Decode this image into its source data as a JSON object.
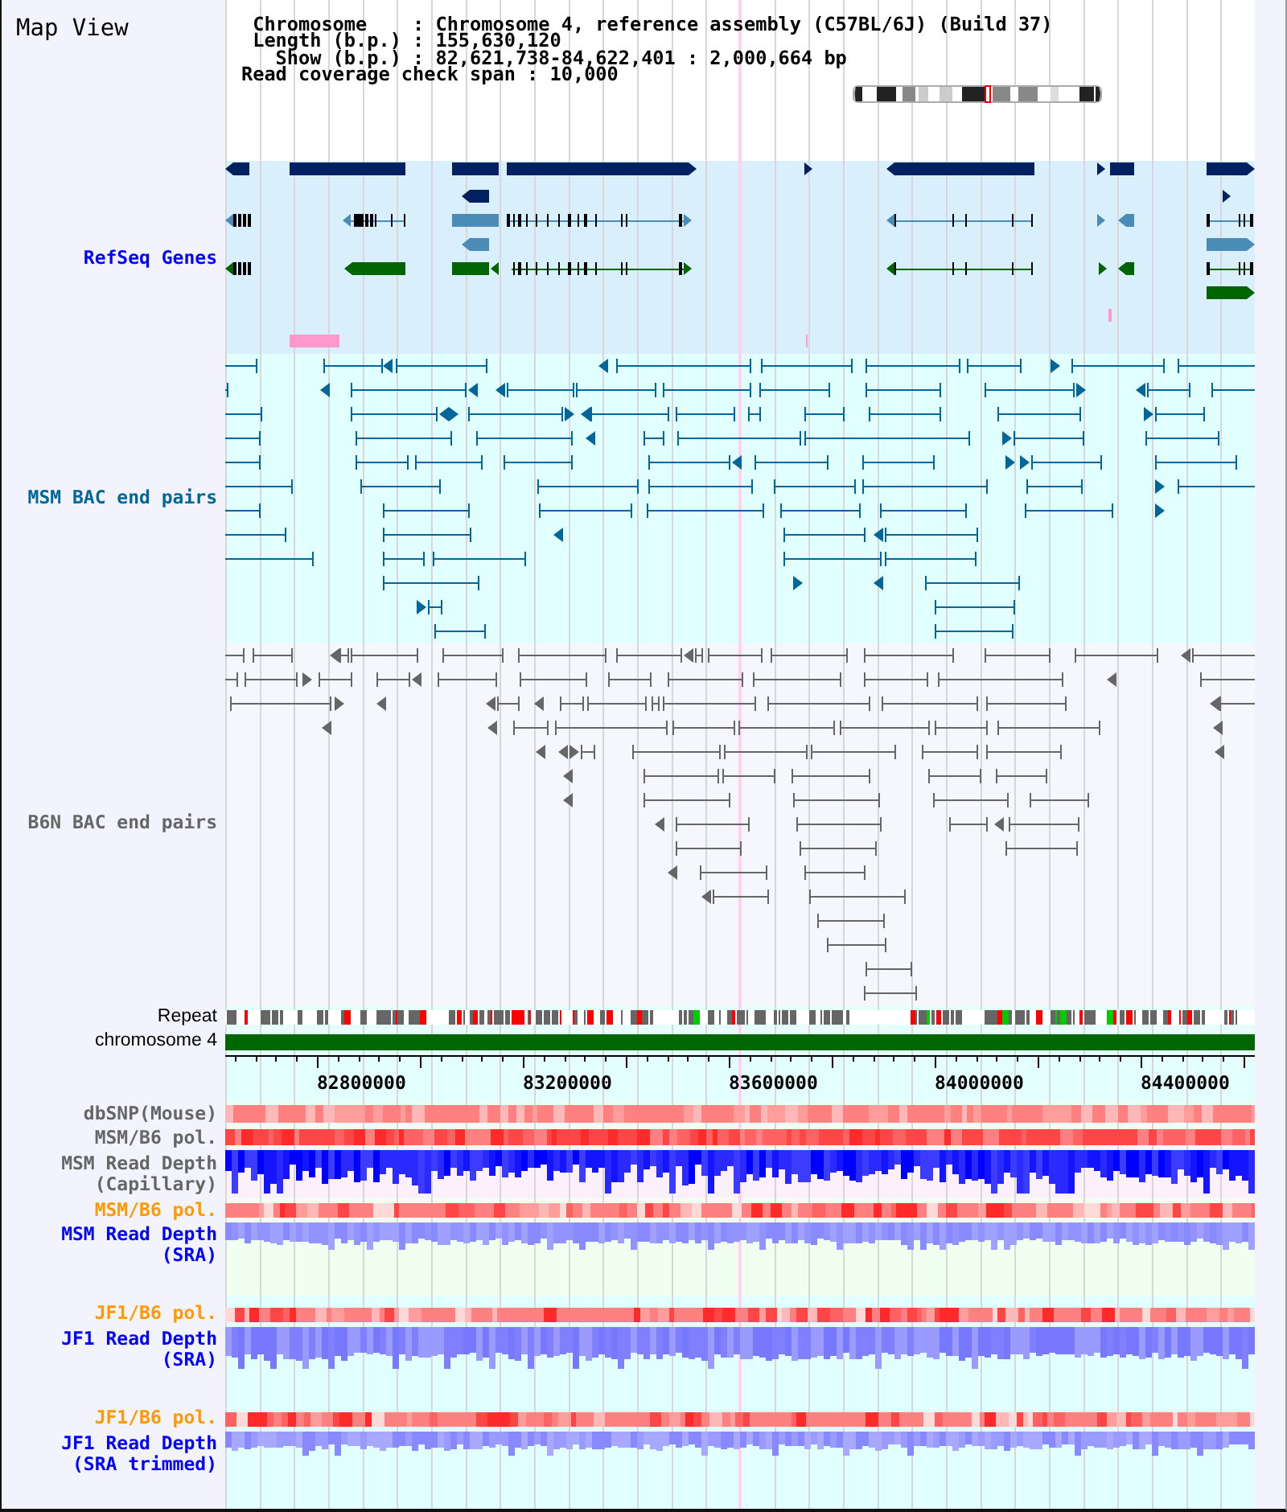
{
  "map_view": {
    "title": "Map View",
    "info_lines": [
      "Chromosome    : Chromosome 4, reference assembly (C57BL/6J) (Build 37)",
      "Length (b.p.) : 155,630,120",
      "Show (b.p.) : 82,621,738-84,622,401 : 2,000,664 bp",
      "Read coverage check span : 10,000"
    ]
  },
  "tracks": [
    {
      "kind": "genes",
      "label_lines": [
        "RefSeq Genes"
      ],
      "color": "#0000ff"
    },
    {
      "kind": "pairs",
      "label_lines": [
        "MSM BAC end pairs"
      ],
      "color": "#006699"
    },
    {
      "kind": "pairs",
      "label_lines": [
        "B6N BAC end pairs"
      ],
      "color": "#666666"
    },
    {
      "kind": "repeat",
      "label_lines": [
        "Repeat"
      ],
      "color": "#000000"
    },
    {
      "kind": "chromosome",
      "label_lines": [
        "chromosome 4"
      ],
      "color": "#000000"
    },
    {
      "kind": "ruler",
      "ticks": [
        "82800000",
        "83200000",
        "83600000",
        "84000000",
        "84400000"
      ]
    },
    {
      "kind": "heat",
      "label_lines": [
        "dbSNP(Mouse)"
      ],
      "color": "#666666"
    },
    {
      "kind": "heat",
      "label_lines": [
        "MSM/B6 pol."
      ],
      "color": "#666666"
    },
    {
      "kind": "coverage",
      "label_lines": [
        "MSM Read Depth",
        "(Capillary)"
      ],
      "color": "#666666"
    },
    {
      "kind": "heat",
      "label_lines": [
        "MSM/B6 pol."
      ],
      "color": "#ff9900"
    },
    {
      "kind": "depth",
      "label_lines": [
        "MSM Read Depth",
        "(SRA)"
      ],
      "color": "#0000ff"
    },
    {
      "kind": "heat",
      "label_lines": [
        "JF1/B6 pol."
      ],
      "color": "#ff9900"
    },
    {
      "kind": "depth",
      "label_lines": [
        "JF1 Read Depth",
        "(SRA)"
      ],
      "color": "#0000ff"
    },
    {
      "kind": "heat",
      "label_lines": [
        "JF1/B6 pol."
      ],
      "color": "#ff9900"
    },
    {
      "kind": "depth",
      "label_lines": [
        "JF1 Read Depth",
        "(SRA trimmed)"
      ],
      "color": "#0000ff"
    }
  ]
}
